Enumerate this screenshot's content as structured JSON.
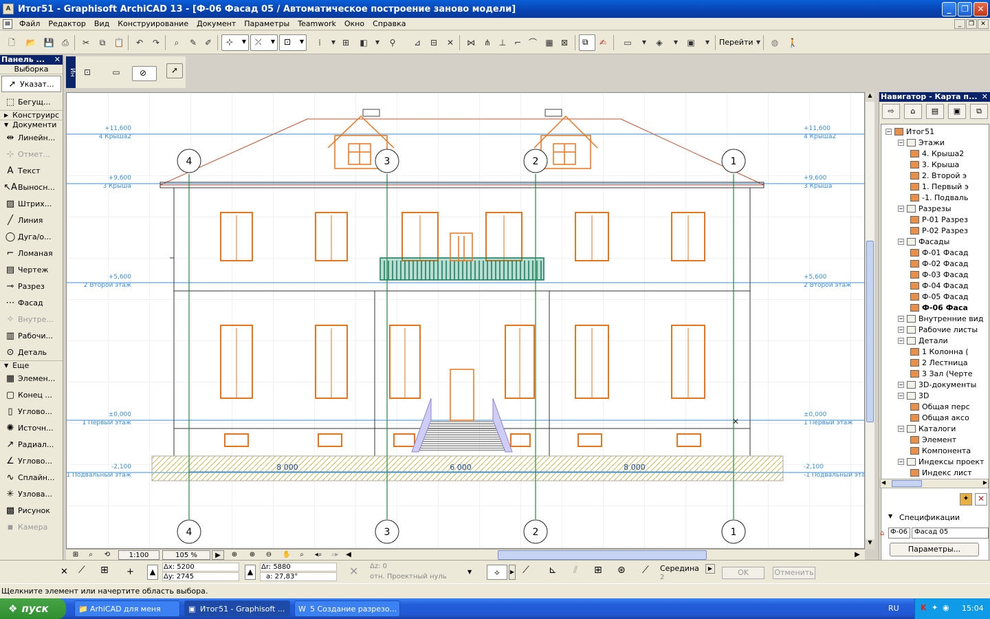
{
  "window": {
    "title": "Итог51 - Graphisoft ArchiCAD 13 - [Ф-06 Фасад 05 / Автоматическое построение заново модели]",
    "app_icon": "archicad-icon"
  },
  "menu": [
    "Файл",
    "Редактор",
    "Вид",
    "Конструирование",
    "Документ",
    "Параметры",
    "Teamwork",
    "Окно",
    "Справка"
  ],
  "toolbar": {
    "goto_label": "Перейти"
  },
  "toolbox": {
    "title": "Панель ...",
    "selection_label": "Выборка",
    "tools_top": [
      {
        "label": "Указат...",
        "icon": "pointer-icon"
      },
      {
        "label": "Бегущ...",
        "icon": "marquee-icon"
      }
    ],
    "group_construct": "Конструирс",
    "group_document": "Документи",
    "tools_doc": [
      {
        "label": "Линейн...",
        "icon": "linear-dimension-icon"
      },
      {
        "label": "Отмет...",
        "icon": "level-dimension-icon"
      },
      {
        "label": "Текст",
        "icon": "text-icon"
      },
      {
        "label": "Выносн...",
        "icon": "label-icon"
      },
      {
        "label": "Штрих...",
        "icon": "fill-icon"
      },
      {
        "label": "Линия",
        "icon": "line-icon"
      },
      {
        "label": "Дуга/о...",
        "icon": "arc-icon"
      },
      {
        "label": "Ломаная",
        "icon": "polyline-icon"
      },
      {
        "label": "Чертеж",
        "icon": "drawing-icon"
      },
      {
        "label": "Разрез",
        "icon": "section-icon"
      },
      {
        "label": "Фасад",
        "icon": "elevation-icon"
      },
      {
        "label": "Внутре...",
        "icon": "interior-elevation-icon"
      },
      {
        "label": "Рабочи...",
        "icon": "worksheet-icon"
      },
      {
        "label": "Деталь",
        "icon": "detail-icon"
      }
    ],
    "group_more": "Еще",
    "tools_more": [
      {
        "label": "Элемен...",
        "icon": "element-icon"
      },
      {
        "label": "Конец ...",
        "icon": "end-icon"
      },
      {
        "label": "Углово...",
        "icon": "angle-icon"
      },
      {
        "label": "Источн...",
        "icon": "light-source-icon"
      },
      {
        "label": "Радиал...",
        "icon": "radial-dimension-icon"
      },
      {
        "label": "Углово...",
        "icon": "angle-dimension-icon"
      },
      {
        "label": "Сплайн...",
        "icon": "spline-icon"
      },
      {
        "label": "Узлова...",
        "icon": "hotspot-icon"
      },
      {
        "label": "Рисунок",
        "icon": "figure-icon"
      },
      {
        "label": "Камера",
        "icon": "camera-icon"
      }
    ]
  },
  "infobox_tab": "Ин",
  "drawing": {
    "levels": [
      {
        "value": "+11,600",
        "name": "4 Крыша2"
      },
      {
        "value": "+9,600",
        "name": "3 Крыша"
      },
      {
        "value": "+5,600",
        "name": "2 Второй этаж"
      },
      {
        "value": "±0,000",
        "name": "1 Первый этаж"
      },
      {
        "value": "-2,100",
        "name": "-1 Подвальный этаж"
      }
    ],
    "axes": [
      "4",
      "3",
      "2",
      "1"
    ],
    "dimensions": [
      "8 000",
      "6 000",
      "8 000"
    ]
  },
  "hscroll": {
    "scale": "1:100",
    "zoom": "105 %"
  },
  "navigator": {
    "title": "Навигатор - Карта п...",
    "tree": [
      {
        "label": "Итог51",
        "level": 0
      },
      {
        "label": "Этажи",
        "level": 1
      },
      {
        "label": "4. Крыша2",
        "level": 2
      },
      {
        "label": "3. Крыша",
        "level": 2
      },
      {
        "label": "2. Второй э",
        "level": 2
      },
      {
        "label": "1. Первый э",
        "level": 2
      },
      {
        "label": "-1. Подваль",
        "level": 2
      },
      {
        "label": "Разрезы",
        "level": 1
      },
      {
        "label": "Р-01 Разрез",
        "level": 2
      },
      {
        "label": "Р-02 Разрез",
        "level": 2
      },
      {
        "label": "Фасады",
        "level": 1
      },
      {
        "label": "Ф-01 Фасад",
        "level": 2
      },
      {
        "label": "Ф-02 Фасад",
        "level": 2
      },
      {
        "label": "Ф-03 Фасад",
        "level": 2
      },
      {
        "label": "Ф-04 Фасад",
        "level": 2
      },
      {
        "label": "Ф-05 Фасад",
        "level": 2
      },
      {
        "label": "Ф-06 Фаса",
        "level": 2,
        "bold": true
      },
      {
        "label": "Внутренние вид",
        "level": 1
      },
      {
        "label": "Рабочие листы",
        "level": 1
      },
      {
        "label": "Детали",
        "level": 1
      },
      {
        "label": "1 Колонна (",
        "level": 2
      },
      {
        "label": "2 Лестница",
        "level": 2
      },
      {
        "label": "3 Зал (Черте",
        "level": 2
      },
      {
        "label": "3D-документы",
        "level": 1
      },
      {
        "label": "3D",
        "level": 1
      },
      {
        "label": "Общая перс",
        "level": 2
      },
      {
        "label": "Общая аксо",
        "level": 2
      },
      {
        "label": "Каталоги",
        "level": 1
      },
      {
        "label": "Элемент",
        "level": 2
      },
      {
        "label": "Компонента",
        "level": 2
      },
      {
        "label": "Индексы проект",
        "level": 1
      },
      {
        "label": "Индекс лист",
        "level": 2
      }
    ],
    "spec_label": "Спецификации",
    "spec_id": "Ф-06",
    "spec_name": "Фасад 05",
    "params_button": "Параметры..."
  },
  "coords": {
    "dx": "Δx: 5200",
    "dy": "Δy: 2745",
    "dr": "Δr: 5880",
    "da": "a: 27,83°",
    "dz": "Δz: 0",
    "ref": "отн. Проектный нуль",
    "snap": "Середина",
    "snap_n": "2",
    "ok": "OK",
    "cancel": "Отменить"
  },
  "status": "Щелкните элемент или начертите область выбора.",
  "taskbar": {
    "start": "пуск",
    "tasks": [
      "ArhiCAD для меня",
      "Итог51 - Graphisoft ...",
      "5 Создание разрезо..."
    ],
    "lang": "RU",
    "time": "15:04"
  },
  "colors": {
    "title_blue": "#0842b0",
    "level_line": "#3b8ed8",
    "axis_green": "#1f8a3a",
    "window_orange": "#e8741c",
    "roof_red": "#c0502c",
    "balcony_green": "#0f7a5a",
    "stair_violet": "#8a84d8",
    "foundation_hatch": "#d8cc78"
  }
}
